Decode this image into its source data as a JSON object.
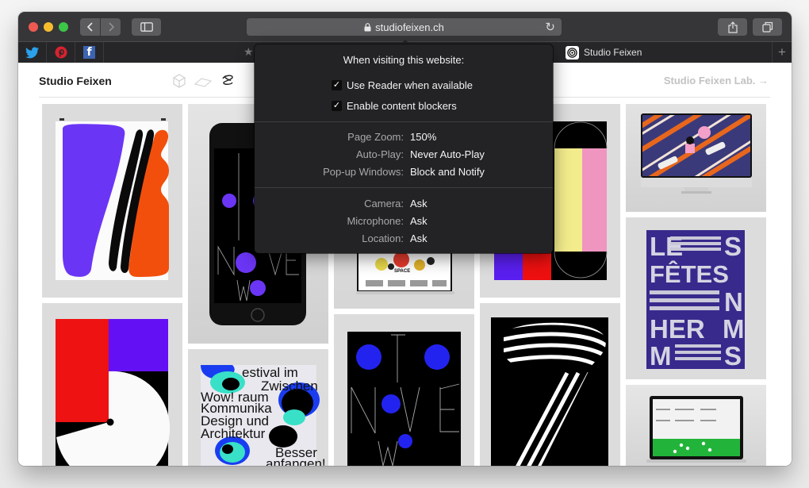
{
  "browser": {
    "address": "studiofeixen.ch",
    "icons": {
      "back": "chevron-left-icon",
      "forward": "chevron-right-icon",
      "sidebar": "sidebar-icon",
      "lock": "lock-icon",
      "reload": "reload-icon",
      "share": "share-icon",
      "tabs": "tabs-overview-icon"
    },
    "favorites": [
      {
        "name": "Twitter",
        "glyph": "🐦"
      },
      {
        "name": "Pinterest",
        "glyph": "℗"
      },
      {
        "name": "Facebook",
        "glyph": "f"
      }
    ],
    "tab": {
      "title": "Studio Feixen"
    },
    "new_tab_glyph": "+"
  },
  "site": {
    "brand": "Studio Feixen",
    "lab_link": "Studio Feixen Lab. →",
    "header_icons": [
      "cube-icon",
      "plane-icon",
      "coil-icon"
    ]
  },
  "popover": {
    "title": "When visiting this website:",
    "checkboxes": [
      {
        "label": "Use Reader when available",
        "checked": true
      },
      {
        "label": "Enable content blockers",
        "checked": true
      }
    ],
    "settings": [
      {
        "label": "Page Zoom:",
        "value": "150%"
      },
      {
        "label": "Auto-Play:",
        "value": "Never Auto-Play"
      },
      {
        "label": "Pop-up Windows:",
        "value": "Block and Notify"
      }
    ],
    "permissions": [
      {
        "label": "Camera:",
        "value": "Ask"
      },
      {
        "label": "Microphone:",
        "value": "Ask"
      },
      {
        "label": "Location:",
        "value": "Ask"
      }
    ]
  },
  "grid": {
    "tiles": [
      {
        "name": "poster-blob-shapes"
      },
      {
        "name": "phone-november-poster"
      },
      {
        "name": "laptop-space-site"
      },
      {
        "name": "poster-color-bars"
      },
      {
        "name": "imac-striped-illustration"
      },
      {
        "name": "poster-les-fetes-en-hermes",
        "text": [
          "LE",
          "S",
          "FÊTES",
          "EN",
          "HER",
          "M",
          "S"
        ]
      },
      {
        "name": "poster-red-violet-circle"
      },
      {
        "name": "poster-festival-zwischenraum",
        "text": [
          "Festival im",
          "Zwischen",
          "Wow! raum",
          "Kommunika",
          "Design und",
          "Architektur",
          "Besser",
          "anfangen!"
        ]
      },
      {
        "name": "poster-november-blue-dots",
        "text": [
          "N",
          "V",
          "É",
          "W"
        ]
      },
      {
        "name": "poster-striped-seven"
      },
      {
        "name": "laptop-green-site"
      }
    ],
    "laptop_caption": "SPACE"
  },
  "colors": {
    "toolbar": "#363638",
    "popover": "#232325",
    "violet": "#6b35f5",
    "orange": "#f24f0c",
    "blue": "#2323f0",
    "hermes_blue": "#382a8c"
  }
}
